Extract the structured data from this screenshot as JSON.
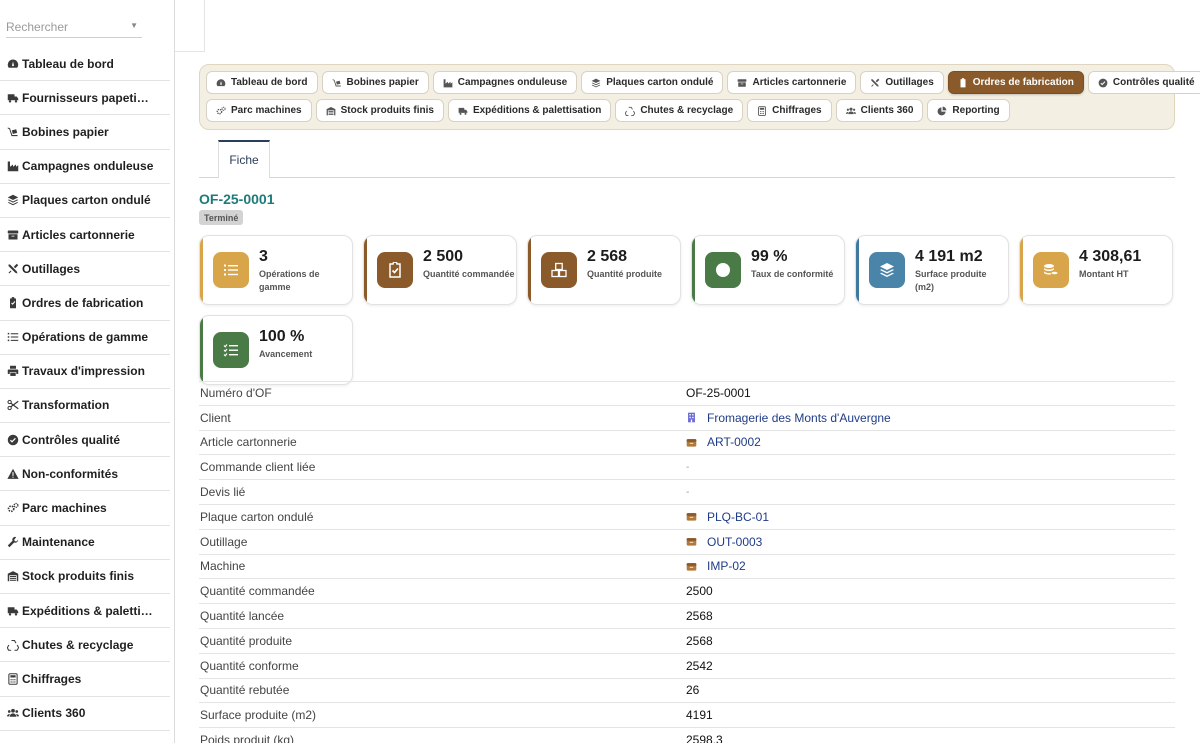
{
  "search": {
    "placeholder": "Rechercher"
  },
  "sidebar": {
    "items": [
      {
        "label": "Tableau de bord",
        "icon": "gauge-icon"
      },
      {
        "label": "Fournisseurs papeti…",
        "icon": "truck-icon"
      },
      {
        "label": "Bobines papier",
        "icon": "dolly-icon"
      },
      {
        "label": "Campagnes onduleuse",
        "icon": "industry-icon"
      },
      {
        "label": "Plaques carton ondulé",
        "icon": "layers-icon"
      },
      {
        "label": "Articles cartonnerie",
        "icon": "archive-icon"
      },
      {
        "label": "Outillages",
        "icon": "tools-icon"
      },
      {
        "label": "Ordres de fabrication",
        "icon": "clipboard-icon"
      },
      {
        "label": "Opérations de gamme",
        "icon": "list-icon"
      },
      {
        "label": "Travaux d'impression",
        "icon": "print-icon"
      },
      {
        "label": "Transformation",
        "icon": "scissors-icon"
      },
      {
        "label": "Contrôles qualité",
        "icon": "check-circle-icon"
      },
      {
        "label": "Non-conformités",
        "icon": "warning-icon"
      },
      {
        "label": "Parc machines",
        "icon": "cogs-icon"
      },
      {
        "label": "Maintenance",
        "icon": "wrench-icon"
      },
      {
        "label": "Stock produits finis",
        "icon": "warehouse-icon"
      },
      {
        "label": "Expéditions & paletti…",
        "icon": "truck-icon"
      },
      {
        "label": "Chutes & recyclage",
        "icon": "recycle-icon"
      },
      {
        "label": "Chiffrages",
        "icon": "calculator-icon"
      },
      {
        "label": "Clients 360",
        "icon": "users-icon"
      }
    ]
  },
  "modules": {
    "row1": [
      {
        "label": "Tableau de bord",
        "icon": "gauge-icon",
        "active": false
      },
      {
        "label": "Bobines papier",
        "icon": "dolly-icon",
        "active": false
      },
      {
        "label": "Campagnes onduleuse",
        "icon": "industry-icon",
        "active": false
      },
      {
        "label": "Plaques carton ondulé",
        "icon": "layers-icon",
        "active": false
      },
      {
        "label": "Articles cartonnerie",
        "icon": "archive-icon",
        "active": false
      },
      {
        "label": "Outillages",
        "icon": "tools-icon",
        "active": false
      },
      {
        "label": "Ordres de fabrication",
        "icon": "clipboard-icon",
        "active": true
      },
      {
        "label": "Contrôles qualité",
        "icon": "check-circle-icon",
        "active": false
      }
    ],
    "row2": [
      {
        "label": "Parc machines",
        "icon": "cogs-icon",
        "active": false
      },
      {
        "label": "Stock produits finis",
        "icon": "warehouse-icon",
        "active": false
      },
      {
        "label": "Expéditions & palettisation",
        "icon": "truck-icon",
        "active": false
      },
      {
        "label": "Chutes & recyclage",
        "icon": "recycle-icon",
        "active": false
      },
      {
        "label": "Chiffrages",
        "icon": "calculator-icon",
        "active": false
      },
      {
        "label": "Clients 360",
        "icon": "users-icon",
        "active": false
      },
      {
        "label": "Reporting",
        "icon": "chart-pie-icon",
        "active": false
      }
    ]
  },
  "tabs": {
    "fiche": "Fiche"
  },
  "record": {
    "title": "OF-25-0001",
    "status": "Terminé"
  },
  "kpis": [
    {
      "value": "3",
      "label": "Opérations de gamme",
      "icon": "list-icon",
      "bar": "#d9a54a",
      "color": "#d9a54a"
    },
    {
      "value": "2 500",
      "label": "Quantité commandée",
      "icon": "clipboard-check-icon",
      "bar": "#8a5a2b",
      "color": "#8a5a2b"
    },
    {
      "value": "2 568",
      "label": "Quantité produite",
      "icon": "boxes-icon",
      "bar": "#8a5a2b",
      "color": "#8a5a2b"
    },
    {
      "value": "99 %",
      "label": "Taux de conformité",
      "icon": "check-circle-icon",
      "bar": "#4a7a45",
      "color": "#4a7a45"
    },
    {
      "value": "4 191 m2",
      "label": "Surface produite (m2)",
      "icon": "layers-icon",
      "bar": "#3f7a9e",
      "color": "#4a84a8"
    },
    {
      "value": "4 308,61",
      "label": "Montant HT",
      "icon": "coins-icon",
      "bar": "#d9a54a",
      "color": "#d9a54a"
    },
    {
      "value": "100 %",
      "label": "Avancement",
      "icon": "tasks-icon",
      "bar": "#4a7a45",
      "color": "#4a7a45"
    }
  ],
  "details": [
    {
      "label": "Numéro d'OF",
      "value": "OF-25-0001",
      "type": "text"
    },
    {
      "label": "Client",
      "value": "Fromagerie des Monts d'Auvergne",
      "type": "link",
      "icon": "building-icon"
    },
    {
      "label": "Article cartonnerie",
      "value": "ART-0002",
      "type": "link",
      "icon": "box-icon"
    },
    {
      "label": "Commande client liée",
      "value": "-",
      "type": "empty"
    },
    {
      "label": "Devis lié",
      "value": "-",
      "type": "empty"
    },
    {
      "label": "Plaque carton ondulé",
      "value": "PLQ-BC-01",
      "type": "link",
      "icon": "box-icon"
    },
    {
      "label": "Outillage",
      "value": "OUT-0003",
      "type": "link",
      "icon": "box-icon"
    },
    {
      "label": "Machine",
      "value": "IMP-02",
      "type": "link",
      "icon": "box-icon"
    },
    {
      "label": "Quantité commandée",
      "value": "2500",
      "type": "text"
    },
    {
      "label": "Quantité lancée",
      "value": "2568",
      "type": "text"
    },
    {
      "label": "Quantité produite",
      "value": "2568",
      "type": "text"
    },
    {
      "label": "Quantité conforme",
      "value": "2542",
      "type": "text"
    },
    {
      "label": "Quantité rebutée",
      "value": "26",
      "type": "text"
    },
    {
      "label": "Surface produite (m2)",
      "value": "4191",
      "type": "text"
    },
    {
      "label": "Poids produit (kg)",
      "value": "2598.3",
      "type": "text"
    }
  ]
}
